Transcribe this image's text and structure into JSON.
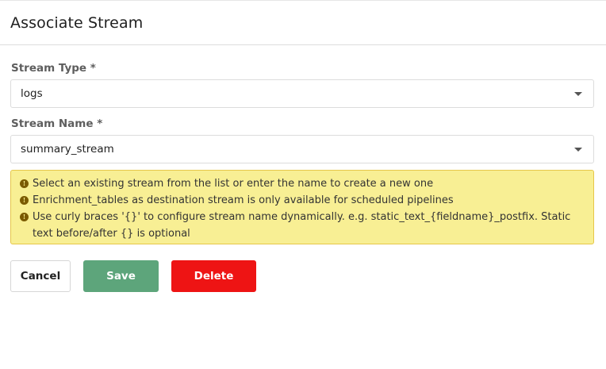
{
  "dialog": {
    "title": "Associate Stream"
  },
  "stream_type": {
    "label": "Stream Type *",
    "value": "logs"
  },
  "stream_name": {
    "label": "Stream Name *",
    "value": "summary_stream"
  },
  "notice": {
    "icon": "info-icon",
    "background": "#f8ef94",
    "messages": [
      "Select an existing stream from the list or enter the name to create a new one",
      "Enrichment_tables as destination stream is only available for scheduled pipelines",
      "Use curly braces '{}' to configure stream name dynamically. e.g. static_text_{fieldname}_postfix. Static text before/after {} is optional"
    ]
  },
  "actions": {
    "cancel_label": "Cancel",
    "save_label": "Save",
    "delete_label": "Delete",
    "save_color": "#5da57b",
    "delete_color": "#ee1414"
  }
}
